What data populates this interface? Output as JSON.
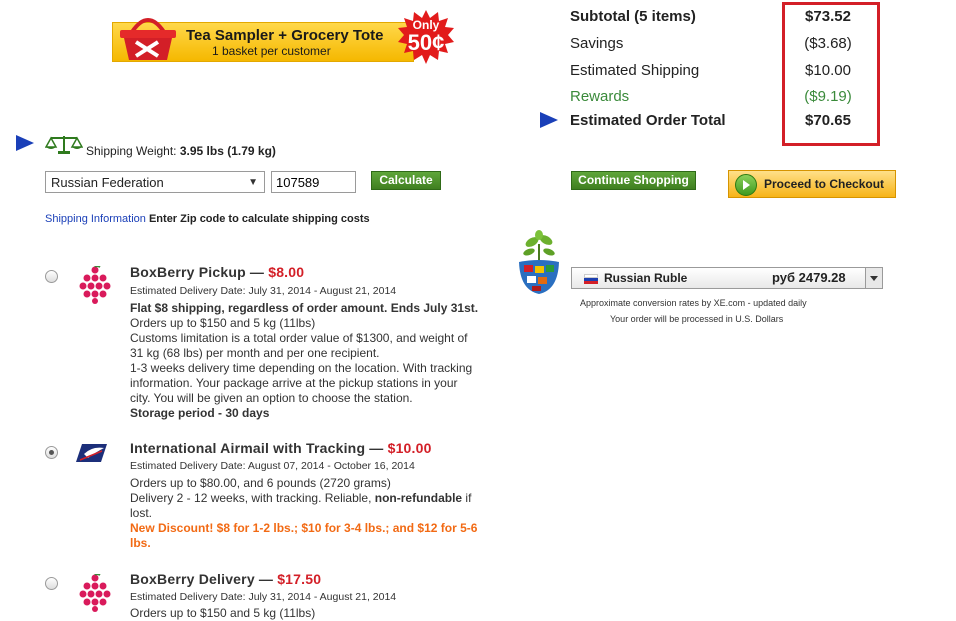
{
  "banner": {
    "title": "Tea Sampler + Grocery Tote",
    "subtitle": "1 basket per customer",
    "badge_top": "Only",
    "badge_price": "50¢"
  },
  "totals": {
    "subtotal_label": "Subtotal (5 items)",
    "subtotal_value": "$73.52",
    "savings_label": "Savings",
    "savings_value": "($3.68)",
    "shipping_label": "Estimated Shipping",
    "shipping_value": "$10.00",
    "rewards_label": "Rewards",
    "rewards_value": "($9.19)",
    "order_total_label": "Estimated Order Total",
    "order_total_value": "$70.65"
  },
  "shipping_weight": {
    "label": "Shipping Weight:",
    "value": "3.95 lbs (1.79 kg)"
  },
  "country_select": {
    "value": "Russian Federation"
  },
  "zip_input": {
    "value": "107589"
  },
  "buttons": {
    "calculate": "Calculate",
    "continue_shopping": "Continue Shopping",
    "checkout": "Proceed to Checkout"
  },
  "shipping_info": {
    "link": "Shipping Information",
    "instruction": "Enter Zip code to calculate shipping costs"
  },
  "shipping_options": [
    {
      "name": "BoxBerry Pickup — ",
      "price": "$8.00",
      "delivery": "Estimated Delivery Date: July 31, 2014 - August 21, 2014",
      "line1": "Flat $8 shipping, regardless of order amount. Ends July 31st.",
      "line2": "Orders up to $150 and 5 kg (11lbs)",
      "line3": "Customs limitation is a total order value of $1300, and weight of 31 kg (68 lbs) per month and per one recipient.",
      "line4": "1-3 weeks delivery time depending on the location. With tracking information. Your package arrive at the pickup stations in your city. You will be given an option to choose the station.",
      "line5": "Storage period - 30 days",
      "selected": false
    },
    {
      "name": "International Airmail with Tracking — ",
      "price": "$10.00",
      "delivery": "Estimated Delivery Date: August 07, 2014 - October 16, 2014",
      "line1": "Orders up to $80.00, and 6 pounds (2720 grams)",
      "line2a": "Delivery 2 - 12 weeks, with tracking. Reliable, ",
      "line2b": "non-refundable",
      "line2c": " if lost.",
      "discount": "New Discount! $8 for 1-2 lbs.; $10 for 3-4 lbs.; and $12 for 5-6 lbs.",
      "selected": true
    },
    {
      "name": "BoxBerry Delivery — ",
      "price": "$17.50",
      "delivery": "Estimated Delivery Date: July 31, 2014 - August 21, 2014",
      "line1": "Orders up to $150 and 5 kg (11lbs)",
      "selected": false
    }
  ],
  "currency": {
    "name": "Russian Ruble",
    "amount": "руб 2479.28",
    "note1": "Approximate conversion rates by XE.com - updated daily",
    "note2": "Your order will be processed in U.S. Dollars"
  },
  "colors": {
    "accent_red": "#d31f27",
    "rewards_green": "#3a8a3a",
    "button_green": "#4f9330",
    "checkout_orange": "#f7b418",
    "discount_orange": "#f26a14",
    "link_blue": "#1a3fb8"
  }
}
